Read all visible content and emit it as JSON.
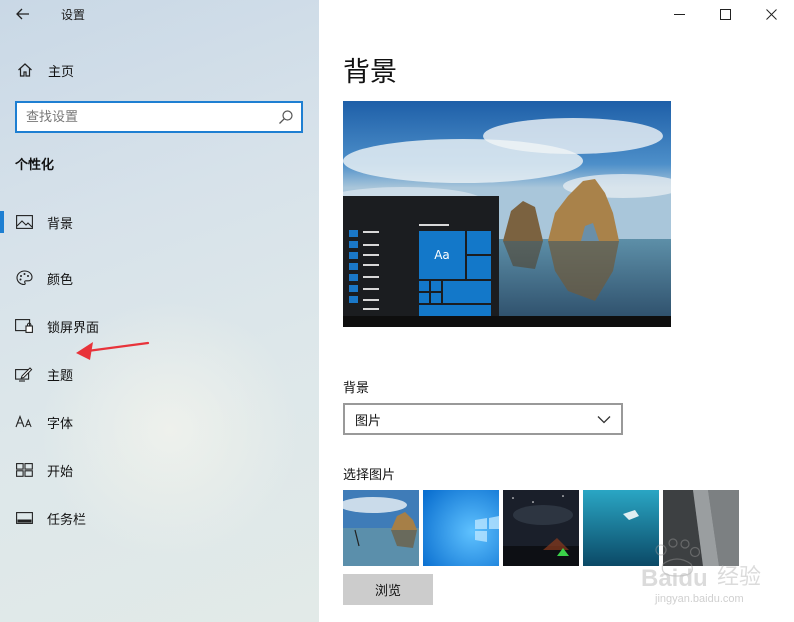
{
  "window": {
    "title": "设置"
  },
  "sidebar": {
    "home_label": "主页",
    "search": {
      "placeholder": "查找设置"
    },
    "section_title": "个性化",
    "items": [
      {
        "label": "背景",
        "icon": "picture-icon",
        "active": true
      },
      {
        "label": "颜色",
        "icon": "palette-icon"
      },
      {
        "label": "锁屏界面",
        "icon": "lock-screen-icon"
      },
      {
        "label": "主题",
        "icon": "theme-pen-icon"
      },
      {
        "label": "字体",
        "icon": "font-icon"
      },
      {
        "label": "开始",
        "icon": "start-icon"
      },
      {
        "label": "任务栏",
        "icon": "taskbar-icon"
      }
    ]
  },
  "main": {
    "title": "背景",
    "preview": {
      "tile_text": "Aa"
    },
    "background_section": {
      "label": "背景",
      "selected": "图片"
    },
    "choose_picture": {
      "label": "选择图片",
      "thumbnails": [
        "beach-rock-thumbnail",
        "windows-blue-thumbnail",
        "night-sky-tent-thumbnail",
        "underwater-swimmer-thumbnail",
        "rock-face-thumbnail"
      ]
    },
    "browse_label": "浏览"
  },
  "watermark": {
    "line1": "Baidu 经验",
    "line2": "jingyan.baidu.com"
  },
  "colors": {
    "accent": "#1e7fd2",
    "annotation_arrow": "#e8333a",
    "tile_blue": "#1378c9"
  }
}
